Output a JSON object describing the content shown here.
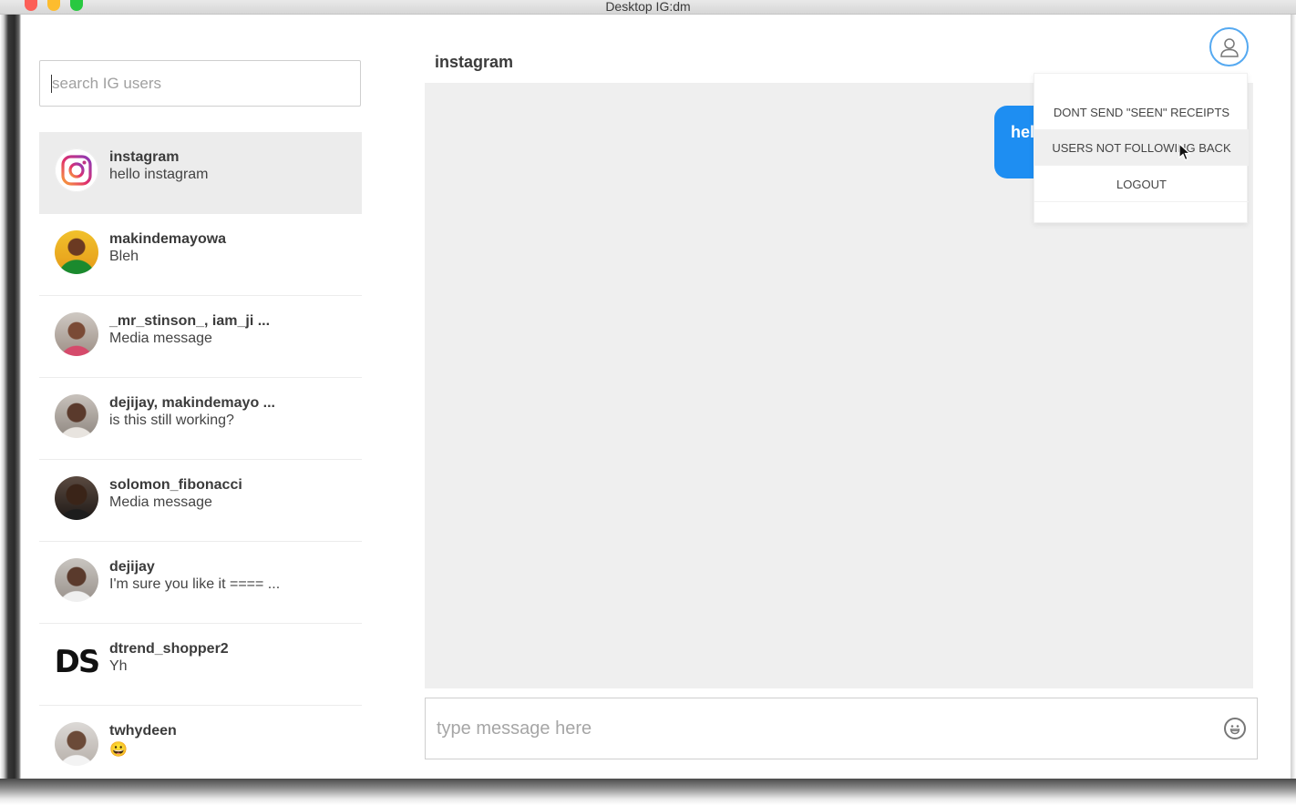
{
  "window": {
    "title": "Desktop IG:dm"
  },
  "sidebar": {
    "search_placeholder": "search IG users",
    "conversations": [
      {
        "name": "instagram",
        "preview": "hello instagram",
        "active": true
      },
      {
        "name": "makindemayowa",
        "preview": "Bleh"
      },
      {
        "name": "_mr_stinson_, iam_ji ...",
        "preview": "Media message"
      },
      {
        "name": "dejijay, makindemayo ...",
        "preview": "is this still working?"
      },
      {
        "name": "solomon_fibonacci",
        "preview": "Media message"
      },
      {
        "name": "dejijay",
        "preview": "I'm sure you like it ==== ..."
      },
      {
        "name": "dtrend_shopper2",
        "preview": "Yh"
      },
      {
        "name": "twhydeen",
        "preview": "😀"
      }
    ]
  },
  "chat": {
    "title": "instagram",
    "messages": [
      {
        "text": "hello instagram",
        "visible_text": "hel",
        "outgoing": true
      }
    ],
    "composer_placeholder": "type message here"
  },
  "menu": {
    "items": [
      {
        "label": "DONT SEND \"SEEN\" RECEIPTS"
      },
      {
        "label": "USERS NOT FOLLOWING BACK",
        "hovered": true
      },
      {
        "label": "LOGOUT"
      }
    ]
  },
  "colors": {
    "accent": "#1e8ef2",
    "profile_ring": "#55a9f1",
    "chat_bg": "#efefef",
    "active_row": "#ececec"
  },
  "icons": {
    "profile": "user-icon",
    "emoji": "smiley-icon",
    "cursor": "pointer-cursor-icon",
    "app_logo": "instagram-logo-icon"
  }
}
